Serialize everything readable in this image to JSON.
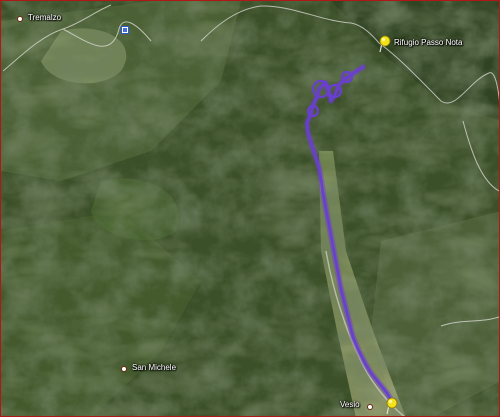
{
  "map": {
    "places": [
      {
        "name": "Tremalzo"
      },
      {
        "name": "Rifugio Passo Nota"
      },
      {
        "name": "San Michele"
      },
      {
        "name": "Vesio"
      }
    ],
    "colors": {
      "route": "#6a3fd0",
      "pin": "#f2e21b",
      "terrain_dark": "#22301a",
      "terrain_light": "#5a7038",
      "road": "#d8d8d0",
      "border": "#b01818"
    },
    "icons": [
      "place-dot-icon",
      "yellow-pushpin-icon",
      "info-marker-icon"
    ]
  }
}
